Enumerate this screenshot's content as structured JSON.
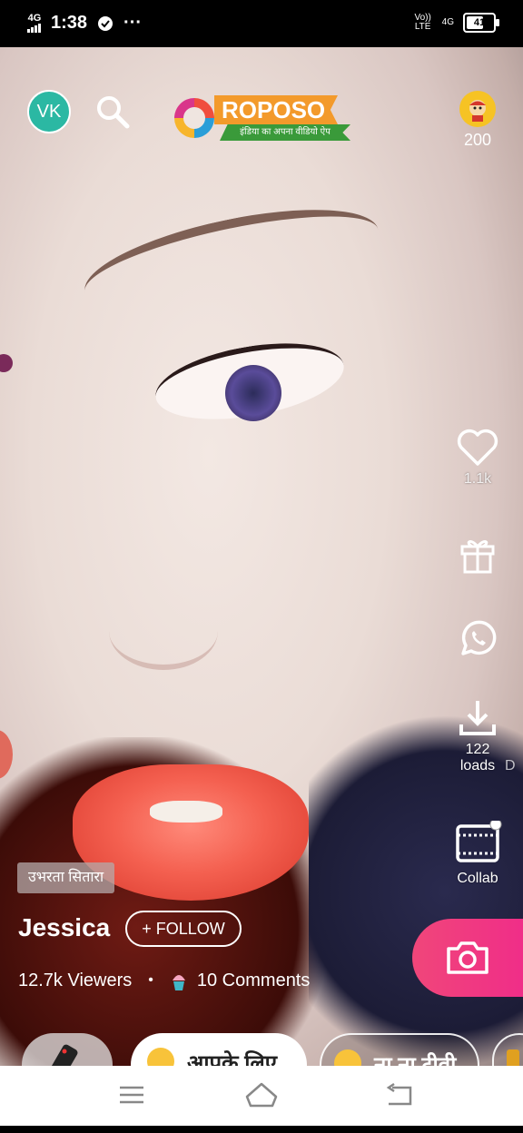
{
  "status_bar": {
    "network_left": "4G",
    "time": "1:38",
    "vpn_icon": "shield-icon",
    "more": "···",
    "volte": "Vo)) LTE",
    "network_right": "4G",
    "battery": "41"
  },
  "header": {
    "avatar_initials": "VK",
    "logo_text": "ROPOSO",
    "logo_tagline": "इंडिया का अपना वीडियो ऐप",
    "coins": "200"
  },
  "actions": {
    "likes": "1.1k",
    "downloads": "122",
    "downloads_label": "loads",
    "downloads_label_extra": "D",
    "collab_label": "Collab"
  },
  "post": {
    "tag": "उभरता सितारा",
    "username": "Jessica",
    "follow_label": "+ FOLLOW",
    "viewers": "12.7k Viewers",
    "separator": "•",
    "comments": "10 Comments"
  },
  "chips": [
    {
      "label": "आपके लिए"
    },
    {
      "label": "ना ना टीवी"
    }
  ],
  "colors": {
    "accent_pink": "#f0467a",
    "avatar_teal": "#2bb8a3",
    "logo_orange": "#f39a2b",
    "logo_green": "#3a9a3a"
  }
}
